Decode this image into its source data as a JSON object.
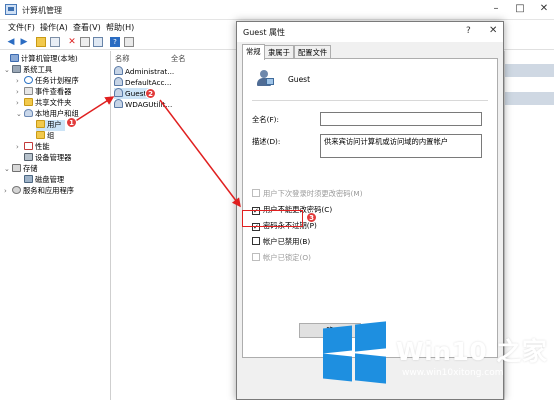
{
  "window": {
    "title": "计算机管理"
  },
  "menu": [
    "文件(F)",
    "操作(A)",
    "查看(V)",
    "帮助(H)"
  ],
  "tree": [
    {
      "label": "计算机管理(本地)"
    },
    {
      "label": "系统工具"
    },
    {
      "label": "任务计划程序"
    },
    {
      "label": "事件查看器"
    },
    {
      "label": "共享文件夹"
    },
    {
      "label": "本地用户和组"
    },
    {
      "label": "用户"
    },
    {
      "label": "组"
    },
    {
      "label": "性能"
    },
    {
      "label": "设备管理器"
    },
    {
      "label": "存储"
    },
    {
      "label": "磁盘管理"
    },
    {
      "label": "服务和应用程序"
    }
  ],
  "list": {
    "columns": [
      "名称",
      "全名"
    ],
    "rows": [
      "Administrat...",
      "DefaultAcc...",
      "Guest",
      "WDAGUtilit..."
    ]
  },
  "dialog": {
    "title": "Guest 属性",
    "help_glyph": "?",
    "close_glyph": "✕",
    "tabs": [
      "常规",
      "隶属于",
      "配置文件"
    ],
    "username": "Guest",
    "fullname_label": "全名(F):",
    "fullname_value": "",
    "desc_label": "描述(D):",
    "desc_value": "供来宾访问计算机或访问域的内置帐户",
    "checkboxes": [
      {
        "label": "用户下次登录时须更改密码(M)",
        "checked": false,
        "disabled": true
      },
      {
        "label": "用户不能更改密码(C)",
        "checked": true,
        "disabled": false
      },
      {
        "label": "密码永不过期(P)",
        "checked": true,
        "disabled": false
      },
      {
        "label": "帐户已禁用(B)",
        "checked": false,
        "disabled": false
      },
      {
        "label": "帐户已锁定(O)",
        "checked": false,
        "disabled": true
      }
    ],
    "ok_label": "确"
  },
  "badges": [
    "1",
    "2",
    "3"
  ],
  "watermark": {
    "title": "Win10 之家",
    "url": "www.win10xitong.com"
  },
  "colors": {
    "highlight": "#e02020",
    "select": "#cce4f7",
    "logo": "#1e8fe0"
  }
}
